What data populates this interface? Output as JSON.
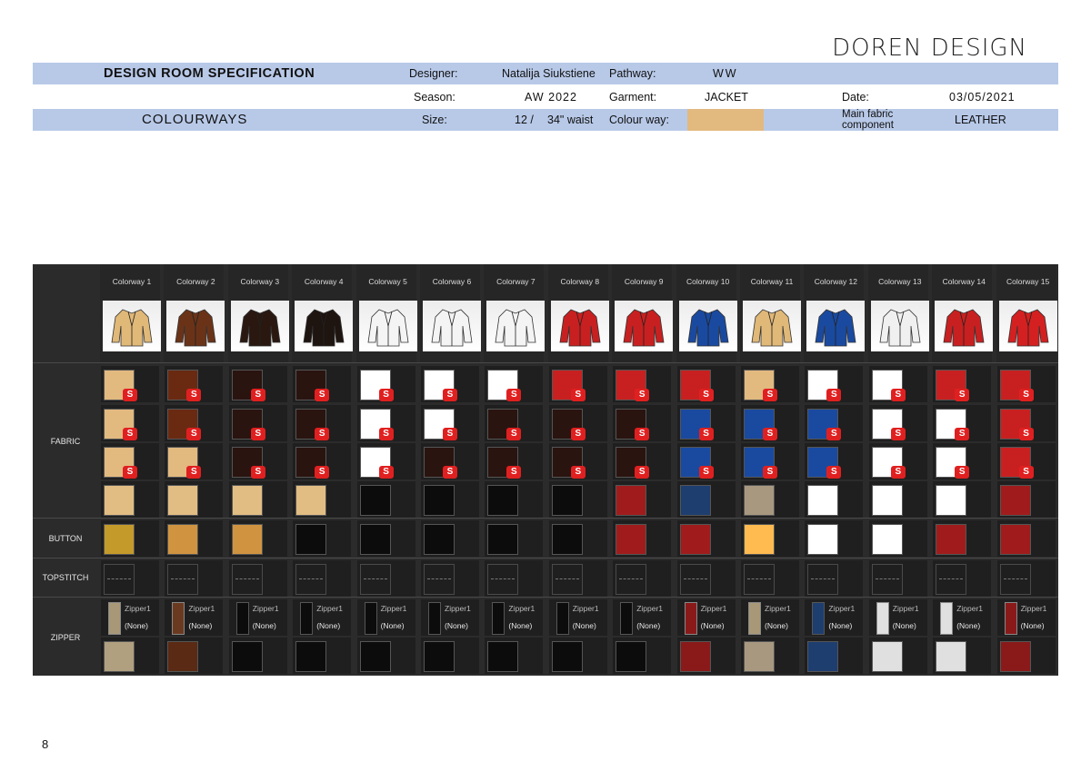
{
  "brand": "DOREN DESIGN",
  "header": {
    "title": "DESIGN ROOM SPECIFICATION",
    "designer_label": "Designer:",
    "designer": "Natalija Siukstiene",
    "pathway_label": "Pathway:",
    "pathway": "WW",
    "season_label": "Season:",
    "season": "AW 2022",
    "garment_label": "Garment:",
    "garment": "JACKET",
    "date_label": "Date:",
    "date": "03/05/2021",
    "section": "COLOURWAYS",
    "size_label": "Size:",
    "size": "12 /",
    "waist": "34\" waist",
    "colourway_label": "Colour way:",
    "colourway_color": "#e2b97f",
    "main_fabric_label": "Main fabric component",
    "main_fabric": "LEATHER"
  },
  "panel": {
    "sections": [
      "FABRIC",
      "BUTTON",
      "TOPSTITCH",
      "ZIPPER"
    ],
    "zipper_label": "Zipper1",
    "none_label": "(None)",
    "colorways": [
      {
        "name": "Colorway 1",
        "jacket": "#e0b878",
        "fabric": [
          "#e2b97f",
          "#e2b97f",
          "#e2b97f",
          "#e2bd83"
        ],
        "button": "#c49a2a",
        "zip": "#a89878",
        "slider": "#b0a080"
      },
      {
        "name": "Colorway 2",
        "jacket": "#6a3318",
        "fabric": [
          "#6a2a12",
          "#6a2a12",
          "#e2b97f",
          "#e2bd83"
        ],
        "button": "#d09440",
        "zip": "#6a3a20",
        "slider": "#5a2a14"
      },
      {
        "name": "Colorway 3",
        "jacket": "#2a1810",
        "fabric": [
          "#2a1410",
          "#2a1410",
          "#2a1410",
          "#e2bd83"
        ],
        "button": "#d09440",
        "zip": "#0c0c0c",
        "slider": "#0c0c0c"
      },
      {
        "name": "Colorway 4",
        "jacket": "#1e1410",
        "fabric": [
          "#2a1410",
          "#2a1410",
          "#2a1410",
          "#e2bd83"
        ],
        "button": "#0c0c0c",
        "zip": "#0c0c0c",
        "slider": "#0c0c0c"
      },
      {
        "name": "Colorway 5",
        "jacket": "#f4f4f4",
        "fabric": [
          "#ffffff",
          "#ffffff",
          "#ffffff",
          "#0c0c0c"
        ],
        "button": "#0c0c0c",
        "zip": "#0c0c0c",
        "slider": "#0c0c0c"
      },
      {
        "name": "Colorway 6",
        "jacket": "#f4f4f4",
        "fabric": [
          "#ffffff",
          "#ffffff",
          "#2a1410",
          "#0c0c0c"
        ],
        "button": "#0c0c0c",
        "zip": "#0c0c0c",
        "slider": "#0c0c0c"
      },
      {
        "name": "Colorway 7",
        "jacket": "#f4f4f4",
        "fabric": [
          "#ffffff",
          "#2a1410",
          "#2a1410",
          "#0c0c0c"
        ],
        "button": "#0c0c0c",
        "zip": "#0c0c0c",
        "slider": "#0c0c0c"
      },
      {
        "name": "Colorway 8",
        "jacket": "#c82020",
        "fabric": [
          "#c82020",
          "#2a1410",
          "#2a1410",
          "#0c0c0c"
        ],
        "button": "#0c0c0c",
        "zip": "#0c0c0c",
        "slider": "#0c0c0c"
      },
      {
        "name": "Colorway 9",
        "jacket": "#c82020",
        "fabric": [
          "#c82020",
          "#2a1410",
          "#2a1410",
          "#a01c1c"
        ],
        "button": "#a01c1c",
        "zip": "#0c0c0c",
        "slider": "#0c0c0c"
      },
      {
        "name": "Colorway 10",
        "jacket": "#1a4aa0",
        "fabric": [
          "#c82020",
          "#1a4aa0",
          "#1a4aa0",
          "#1e3e70"
        ],
        "button": "#a01c1c",
        "zip": "#8a1a1a",
        "slider": "#8a1a1a"
      },
      {
        "name": "Colorway 11",
        "jacket": "#e0b878",
        "fabric": [
          "#e2b97f",
          "#1a4aa0",
          "#1a4aa0",
          "#a89880"
        ],
        "button": "#ffbb50",
        "zip": "#a89878",
        "slider": "#a89880"
      },
      {
        "name": "Colorway 12",
        "jacket": "#1a4aa0",
        "fabric": [
          "#ffffff",
          "#1a4aa0",
          "#1a4aa0",
          "#ffffff"
        ],
        "button": "#ffffff",
        "zip": "#1e3e70",
        "slider": "#1e3e70"
      },
      {
        "name": "Colorway 13",
        "jacket": "#f0f0f0",
        "fabric": [
          "#ffffff",
          "#ffffff",
          "#ffffff",
          "#ffffff"
        ],
        "button": "#ffffff",
        "zip": "#e0e0e0",
        "slider": "#e0e0e0"
      },
      {
        "name": "Colorway 14",
        "jacket": "#c82020",
        "fabric": [
          "#c82020",
          "#ffffff",
          "#ffffff",
          "#ffffff"
        ],
        "button": "#a01c1c",
        "zip": "#e0e0e0",
        "slider": "#e0e0e0"
      },
      {
        "name": "Colorway 15",
        "jacket": "#d42020",
        "fabric": [
          "#c82020",
          "#c82020",
          "#c82020",
          "#a01c1c"
        ],
        "button": "#a01c1c",
        "zip": "#8a1a1a",
        "slider": "#8a1a1a"
      }
    ]
  },
  "page_number": "8"
}
